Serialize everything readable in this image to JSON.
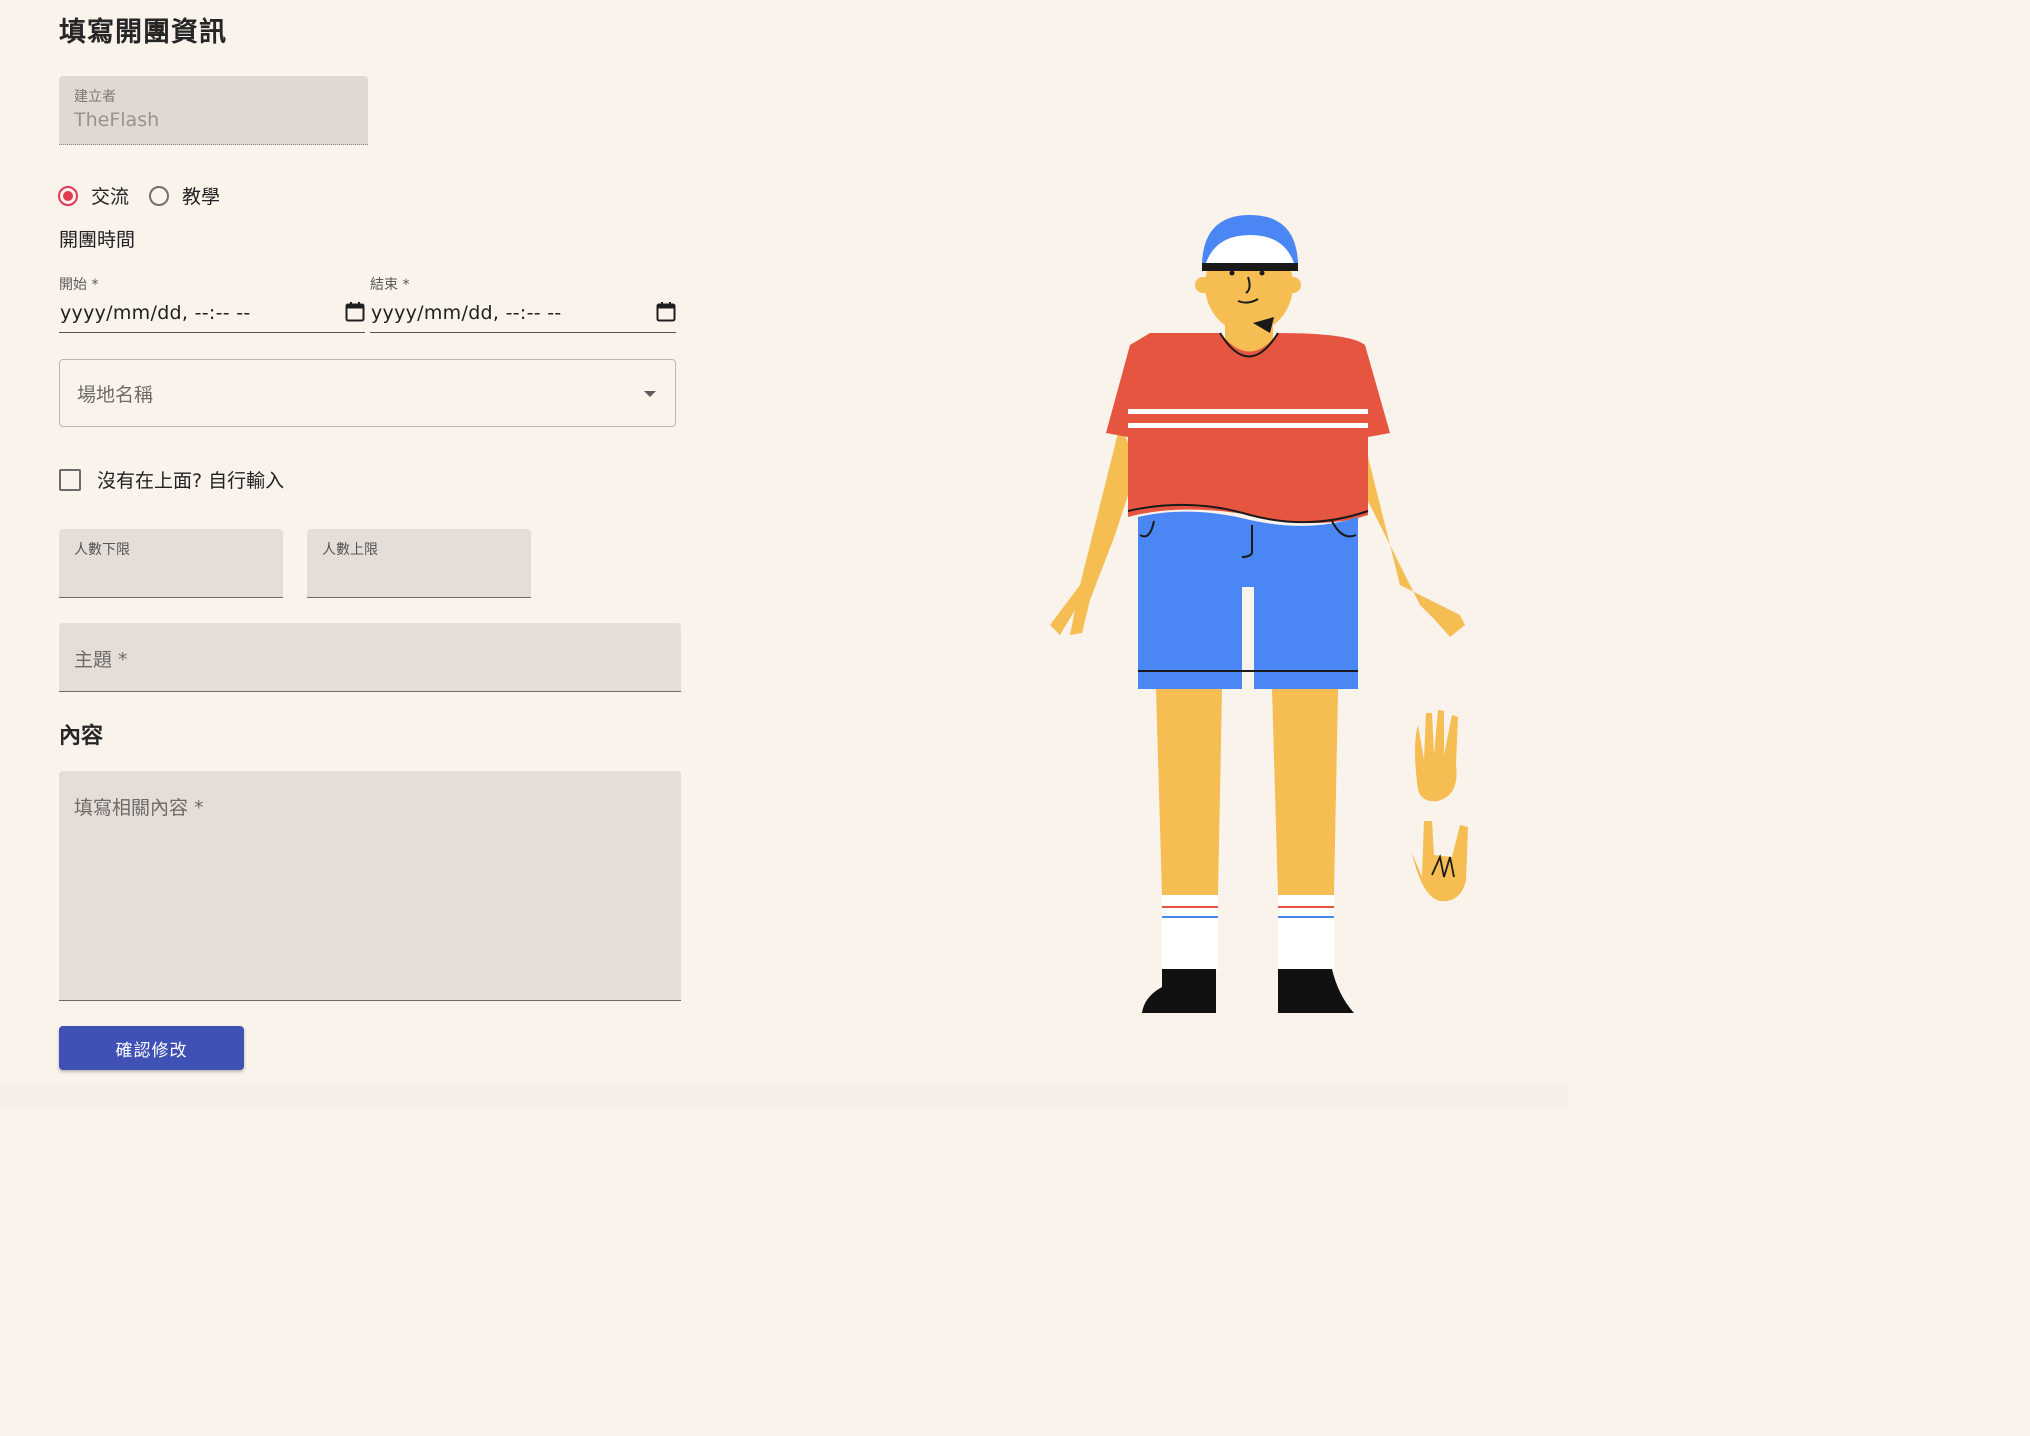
{
  "page": {
    "title": "填寫開團資訊"
  },
  "creator": {
    "label": "建立者",
    "value": "TheFlash"
  },
  "type_options": [
    {
      "label": "交流",
      "selected": true
    },
    {
      "label": "教學",
      "selected": false
    }
  ],
  "schedule": {
    "section_label": "開團時間",
    "start": {
      "label": "開始 *",
      "value": "yyyy/mm/dd, --:-- --"
    },
    "end": {
      "label": "結束 *",
      "value": "yyyy/mm/dd, --:-- --"
    }
  },
  "venue": {
    "placeholder": "場地名稱"
  },
  "custom_venue": {
    "label": "沒有在上面? 自行輸入",
    "checked": false
  },
  "capacity": {
    "min_label": "人數下限",
    "max_label": "人數上限"
  },
  "subject": {
    "placeholder": "主題 *"
  },
  "content": {
    "section_label": "內容",
    "placeholder": "填寫相關內容 *"
  },
  "submit": {
    "label": "確認修改"
  },
  "colors": {
    "background": "#faf3ec",
    "accent_radio": "#e23a52",
    "primary_button": "#3f51b5",
    "field_fill": "#e5ddd7"
  }
}
